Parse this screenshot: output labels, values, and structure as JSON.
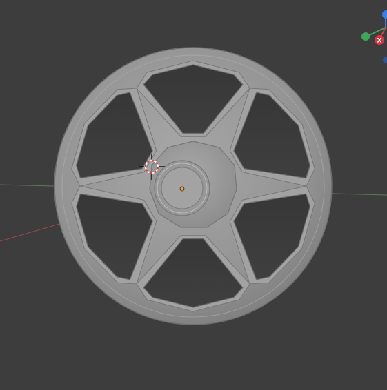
{
  "viewport": {
    "background": "#3d3d3d",
    "grid_x_axis_color": "#c94a4a",
    "grid_y_axis_color": "#6aa34f"
  },
  "object": {
    "name_icon": "wheel-rim-model",
    "spoke_count": 6,
    "surface_color": "#9a9a9a"
  },
  "cursor": {
    "icon": "3d-cursor-icon"
  },
  "origin": {
    "icon": "origin-point-icon",
    "color": "#f0a030"
  },
  "gizmo": {
    "x_label": "X",
    "x_color": "#e0353f",
    "y_color": "#3ea65a",
    "z_color": "#3d7de8"
  }
}
